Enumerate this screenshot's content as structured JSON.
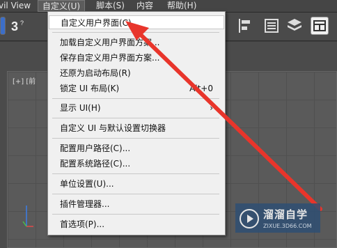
{
  "menubar": {
    "items": [
      {
        "label": "vil View"
      },
      {
        "label": "自定义(U)"
      },
      {
        "label": "脚本(S)"
      },
      {
        "label": "内容"
      },
      {
        "label": "帮助(H)"
      }
    ]
  },
  "viewport": {
    "label": "[+] [前"
  },
  "dropdown": {
    "items": [
      {
        "label": "自定义用户界面(C)...",
        "shortcut": ""
      },
      {
        "label": "加载自定义用户界面方案...",
        "shortcut": ""
      },
      {
        "label": "保存自定义用户界面方案...",
        "shortcut": ""
      },
      {
        "label": "还原为启动布局(R)",
        "shortcut": ""
      },
      {
        "label": "锁定 UI 布局(K)",
        "shortcut": "Alt+0"
      },
      {
        "label": "显示 UI(H)",
        "shortcut": ""
      },
      {
        "label": "自定义 UI 与默认设置切换器",
        "shortcut": ""
      },
      {
        "label": "配置用户路径(C)...",
        "shortcut": ""
      },
      {
        "label": "配置系统路径(C)...",
        "shortcut": ""
      },
      {
        "label": "单位设置(U)...",
        "shortcut": ""
      },
      {
        "label": "插件管理器...",
        "shortcut": ""
      },
      {
        "label": "首选项(P)...",
        "shortcut": ""
      }
    ]
  },
  "watermark": {
    "title": "溜溜自学",
    "subtitle": "ZIXUE.3D66.COM"
  },
  "colors": {
    "arrow": "#e8352b",
    "menu_bg": "#f0f0f0",
    "app_bg": "#454545"
  }
}
